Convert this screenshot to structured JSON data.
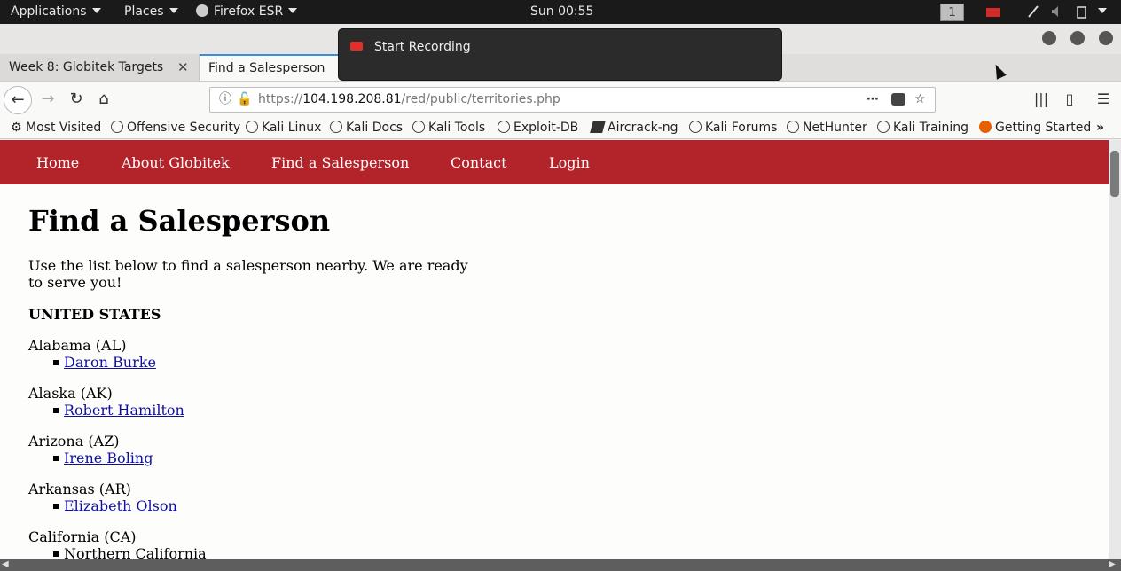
{
  "top_panel": {
    "applications": "Applications",
    "places": "Places",
    "browser": "Firefox ESR",
    "clock": "Sun 00:55",
    "workspace": "1"
  },
  "notification": {
    "text": "Start Recording"
  },
  "tabs": [
    {
      "label": "Week 8: Globitek Targets",
      "active": false
    },
    {
      "label": "Find a Salesperson",
      "active": true
    }
  ],
  "url": {
    "prefix": "https://",
    "host": "104.198.208.81",
    "path": "/red/public/territories.php"
  },
  "bookmarks": [
    "Most Visited",
    "Offensive Security",
    "Kali Linux",
    "Kali Docs",
    "Kali Tools",
    "Exploit-DB",
    "Aircrack-ng",
    "Kali Forums",
    "NetHunter",
    "Kali Training",
    "Getting Started"
  ],
  "site_nav": [
    "Home",
    "About Globitek",
    "Find a Salesperson",
    "Contact",
    "Login"
  ],
  "page": {
    "title": "Find a Salesperson",
    "intro": "Use the list below to find a salesperson nearby. We are ready to serve you!",
    "country": "UNITED STATES",
    "states": [
      {
        "name": "Alabama (AL)",
        "rep": "Daron Burke",
        "link": true
      },
      {
        "name": "Alaska (AK)",
        "rep": "Robert Hamilton",
        "link": true
      },
      {
        "name": "Arizona (AZ)",
        "rep": "Irene Boling",
        "link": true
      },
      {
        "name": "Arkansas (AR)",
        "rep": "Elizabeth Olson",
        "link": true
      },
      {
        "name": "California (CA)",
        "rep": "Northern California",
        "link": false
      }
    ]
  },
  "colors": {
    "site_nav": "#b3232a",
    "link": "#0e0ea0",
    "panel": "#1a1a1a"
  }
}
